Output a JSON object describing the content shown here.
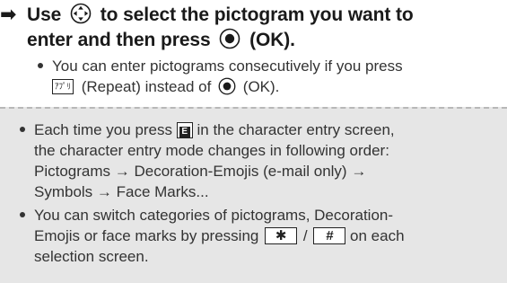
{
  "step": {
    "arrow": "➡",
    "line1_a": "Use",
    "line1_b": "to select the pictogram you want to",
    "line2_a": "enter and then press",
    "line2_b": "(OK)."
  },
  "sub": {
    "line1": "You can enter pictograms consecutively if you press",
    "repeat_key": "ｱﾌﾟﾘ",
    "line2_a": "(Repeat) instead of",
    "line2_b": "(OK)."
  },
  "notes": {
    "n1_l1_a": "Each time you press",
    "n1_key": "E",
    "n1_l1_b": "in the character entry screen,",
    "n1_l2": "the character entry mode changes in following order:",
    "n1_l3": "Pictograms → Decoration-Emojis (e-mail only) →",
    "n1_l4": "Symbols → Face Marks...",
    "n2_l1": "You can switch categories of pictograms, Decoration-",
    "n2_l2_a": "Emojis or face marks by pressing",
    "n2_key1": "✱",
    "n2_sep": "/",
    "n2_key2": "#",
    "n2_l2_b": "on  each",
    "n2_l3": "selection screen."
  },
  "icons": {
    "nav": "multi-direction-key-icon",
    "ok": "ok-center-key-icon"
  }
}
